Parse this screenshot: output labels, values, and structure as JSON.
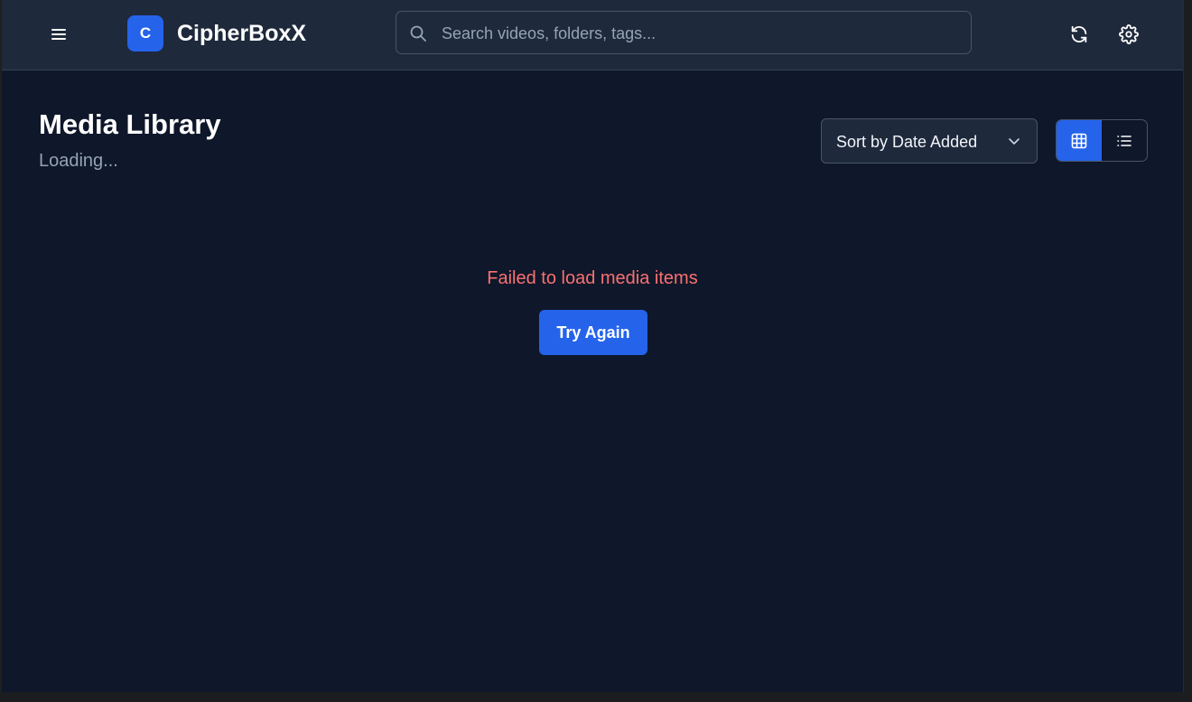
{
  "app": {
    "logo_letter": "C",
    "title": "CipherBoxX"
  },
  "search": {
    "value": "",
    "placeholder": "Search videos, folders, tags..."
  },
  "header_icons": {
    "menu": "hamburger-menu-icon",
    "refresh": "refresh-icon",
    "settings": "gear-icon"
  },
  "main": {
    "title": "Media Library",
    "subtitle": "Loading...",
    "sort": {
      "selected": "Sort by Date Added"
    },
    "view_toggle": {
      "active": "grid",
      "options": [
        "grid",
        "list"
      ]
    },
    "error": {
      "message": "Failed to load media items",
      "retry_label": "Try Again"
    }
  },
  "colors": {
    "background": "#0f172a",
    "header": "#1e293b",
    "accent": "#2563eb",
    "error": "#f87171",
    "muted_text": "#94a3b8"
  }
}
